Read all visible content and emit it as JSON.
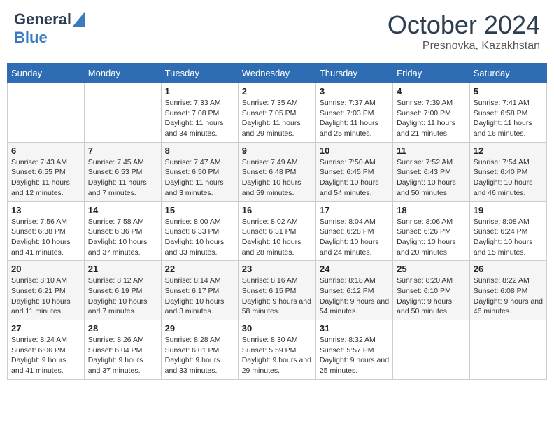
{
  "header": {
    "logo_line1": "General",
    "logo_line2": "Blue",
    "month": "October 2024",
    "location": "Presnovka, Kazakhstan"
  },
  "weekdays": [
    "Sunday",
    "Monday",
    "Tuesday",
    "Wednesday",
    "Thursday",
    "Friday",
    "Saturday"
  ],
  "weeks": [
    [
      {
        "day": "",
        "info": ""
      },
      {
        "day": "",
        "info": ""
      },
      {
        "day": "1",
        "info": "Sunrise: 7:33 AM\nSunset: 7:08 PM\nDaylight: 11 hours and 34 minutes."
      },
      {
        "day": "2",
        "info": "Sunrise: 7:35 AM\nSunset: 7:05 PM\nDaylight: 11 hours and 29 minutes."
      },
      {
        "day": "3",
        "info": "Sunrise: 7:37 AM\nSunset: 7:03 PM\nDaylight: 11 hours and 25 minutes."
      },
      {
        "day": "4",
        "info": "Sunrise: 7:39 AM\nSunset: 7:00 PM\nDaylight: 11 hours and 21 minutes."
      },
      {
        "day": "5",
        "info": "Sunrise: 7:41 AM\nSunset: 6:58 PM\nDaylight: 11 hours and 16 minutes."
      }
    ],
    [
      {
        "day": "6",
        "info": "Sunrise: 7:43 AM\nSunset: 6:55 PM\nDaylight: 11 hours and 12 minutes."
      },
      {
        "day": "7",
        "info": "Sunrise: 7:45 AM\nSunset: 6:53 PM\nDaylight: 11 hours and 7 minutes."
      },
      {
        "day": "8",
        "info": "Sunrise: 7:47 AM\nSunset: 6:50 PM\nDaylight: 11 hours and 3 minutes."
      },
      {
        "day": "9",
        "info": "Sunrise: 7:49 AM\nSunset: 6:48 PM\nDaylight: 10 hours and 59 minutes."
      },
      {
        "day": "10",
        "info": "Sunrise: 7:50 AM\nSunset: 6:45 PM\nDaylight: 10 hours and 54 minutes."
      },
      {
        "day": "11",
        "info": "Sunrise: 7:52 AM\nSunset: 6:43 PM\nDaylight: 10 hours and 50 minutes."
      },
      {
        "day": "12",
        "info": "Sunrise: 7:54 AM\nSunset: 6:40 PM\nDaylight: 10 hours and 46 minutes."
      }
    ],
    [
      {
        "day": "13",
        "info": "Sunrise: 7:56 AM\nSunset: 6:38 PM\nDaylight: 10 hours and 41 minutes."
      },
      {
        "day": "14",
        "info": "Sunrise: 7:58 AM\nSunset: 6:36 PM\nDaylight: 10 hours and 37 minutes."
      },
      {
        "day": "15",
        "info": "Sunrise: 8:00 AM\nSunset: 6:33 PM\nDaylight: 10 hours and 33 minutes."
      },
      {
        "day": "16",
        "info": "Sunrise: 8:02 AM\nSunset: 6:31 PM\nDaylight: 10 hours and 28 minutes."
      },
      {
        "day": "17",
        "info": "Sunrise: 8:04 AM\nSunset: 6:28 PM\nDaylight: 10 hours and 24 minutes."
      },
      {
        "day": "18",
        "info": "Sunrise: 8:06 AM\nSunset: 6:26 PM\nDaylight: 10 hours and 20 minutes."
      },
      {
        "day": "19",
        "info": "Sunrise: 8:08 AM\nSunset: 6:24 PM\nDaylight: 10 hours and 15 minutes."
      }
    ],
    [
      {
        "day": "20",
        "info": "Sunrise: 8:10 AM\nSunset: 6:21 PM\nDaylight: 10 hours and 11 minutes."
      },
      {
        "day": "21",
        "info": "Sunrise: 8:12 AM\nSunset: 6:19 PM\nDaylight: 10 hours and 7 minutes."
      },
      {
        "day": "22",
        "info": "Sunrise: 8:14 AM\nSunset: 6:17 PM\nDaylight: 10 hours and 3 minutes."
      },
      {
        "day": "23",
        "info": "Sunrise: 8:16 AM\nSunset: 6:15 PM\nDaylight: 9 hours and 58 minutes."
      },
      {
        "day": "24",
        "info": "Sunrise: 8:18 AM\nSunset: 6:12 PM\nDaylight: 9 hours and 54 minutes."
      },
      {
        "day": "25",
        "info": "Sunrise: 8:20 AM\nSunset: 6:10 PM\nDaylight: 9 hours and 50 minutes."
      },
      {
        "day": "26",
        "info": "Sunrise: 8:22 AM\nSunset: 6:08 PM\nDaylight: 9 hours and 46 minutes."
      }
    ],
    [
      {
        "day": "27",
        "info": "Sunrise: 8:24 AM\nSunset: 6:06 PM\nDaylight: 9 hours and 41 minutes."
      },
      {
        "day": "28",
        "info": "Sunrise: 8:26 AM\nSunset: 6:04 PM\nDaylight: 9 hours and 37 minutes."
      },
      {
        "day": "29",
        "info": "Sunrise: 8:28 AM\nSunset: 6:01 PM\nDaylight: 9 hours and 33 minutes."
      },
      {
        "day": "30",
        "info": "Sunrise: 8:30 AM\nSunset: 5:59 PM\nDaylight: 9 hours and 29 minutes."
      },
      {
        "day": "31",
        "info": "Sunrise: 8:32 AM\nSunset: 5:57 PM\nDaylight: 9 hours and 25 minutes."
      },
      {
        "day": "",
        "info": ""
      },
      {
        "day": "",
        "info": ""
      }
    ]
  ]
}
